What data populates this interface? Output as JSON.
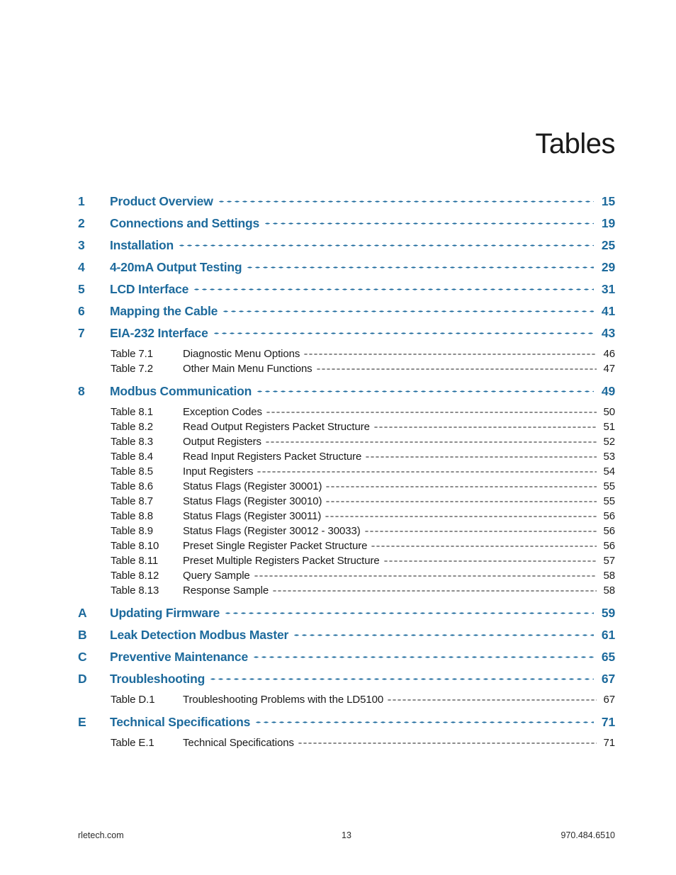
{
  "document": {
    "title": "Tables"
  },
  "colors": {
    "accent_blue": "#1d6a9c",
    "text_black": "#1a1a1a",
    "footer_gray": "#2b2b2b"
  },
  "toc": {
    "entries": [
      {
        "level": 1,
        "num": "1",
        "label": "Product Overview",
        "page": "15"
      },
      {
        "level": 1,
        "num": "2",
        "label": "Connections and Settings",
        "page": "19"
      },
      {
        "level": 1,
        "num": "3",
        "label": "Installation",
        "page": "25"
      },
      {
        "level": 1,
        "num": "4",
        "label": "4-20mA Output Testing",
        "page": "29"
      },
      {
        "level": 1,
        "num": "5",
        "label": "LCD Interface",
        "page": "31"
      },
      {
        "level": 1,
        "num": "6",
        "label": "Mapping the Cable",
        "page": "41"
      },
      {
        "level": 1,
        "num": "7",
        "label": "EIA-232 Interface",
        "page": "43"
      },
      {
        "level": 2,
        "num": "Table 7.1",
        "label": "Diagnostic Menu Options",
        "page": "46"
      },
      {
        "level": 2,
        "num": "Table 7.2",
        "label": "Other Main Menu Functions",
        "page": "47"
      },
      {
        "level": 1,
        "num": "8",
        "label": "Modbus Communication",
        "page": "49"
      },
      {
        "level": 2,
        "num": "Table 8.1",
        "label": "Exception Codes",
        "page": "50"
      },
      {
        "level": 2,
        "num": "Table 8.2",
        "label": "Read Output Registers Packet Structure",
        "page": "51"
      },
      {
        "level": 2,
        "num": "Table 8.3",
        "label": "Output Registers",
        "page": "52"
      },
      {
        "level": 2,
        "num": "Table 8.4",
        "label": "Read Input Registers Packet Structure",
        "page": "53"
      },
      {
        "level": 2,
        "num": "Table 8.5",
        "label": "Input Registers",
        "page": "54"
      },
      {
        "level": 2,
        "num": "Table 8.6",
        "label": "Status Flags (Register 30001)",
        "page": "55"
      },
      {
        "level": 2,
        "num": "Table 8.7",
        "label": "Status Flags (Register 30010)",
        "page": "55"
      },
      {
        "level": 2,
        "num": "Table 8.8",
        "label": "Status Flags (Register 30011)",
        "page": "56"
      },
      {
        "level": 2,
        "num": "Table 8.9",
        "label": "Status Flags (Register 30012 - 30033)",
        "page": "56"
      },
      {
        "level": 2,
        "num": "Table 8.10",
        "label": "Preset Single Register Packet Structure",
        "page": "56"
      },
      {
        "level": 2,
        "num": "Table 8.11",
        "label": "Preset Multiple Registers Packet Structure",
        "page": "57"
      },
      {
        "level": 2,
        "num": "Table 8.12",
        "label": "Query Sample",
        "page": "58"
      },
      {
        "level": 2,
        "num": "Table 8.13",
        "label": "Response Sample",
        "page": "58"
      },
      {
        "level": 1,
        "num": "A",
        "label": "Updating Firmware",
        "page": "59"
      },
      {
        "level": 1,
        "num": "B",
        "label": "Leak Detection Modbus Master",
        "page": "61"
      },
      {
        "level": 1,
        "num": "C",
        "label": "Preventive Maintenance",
        "page": "65"
      },
      {
        "level": 1,
        "num": "D",
        "label": "Troubleshooting",
        "page": "67"
      },
      {
        "level": 2,
        "num": "Table D.1",
        "label": "Troubleshooting Problems with the LD5100",
        "page": "67"
      },
      {
        "level": 1,
        "num": "E",
        "label": "Technical Specifications",
        "page": "71"
      },
      {
        "level": 2,
        "num": "Table E.1",
        "label": "Technical Specifications",
        "page": "71"
      }
    ]
  },
  "footer": {
    "website": "rletech.com",
    "page_number": "13",
    "phone": "970.484.6510"
  }
}
